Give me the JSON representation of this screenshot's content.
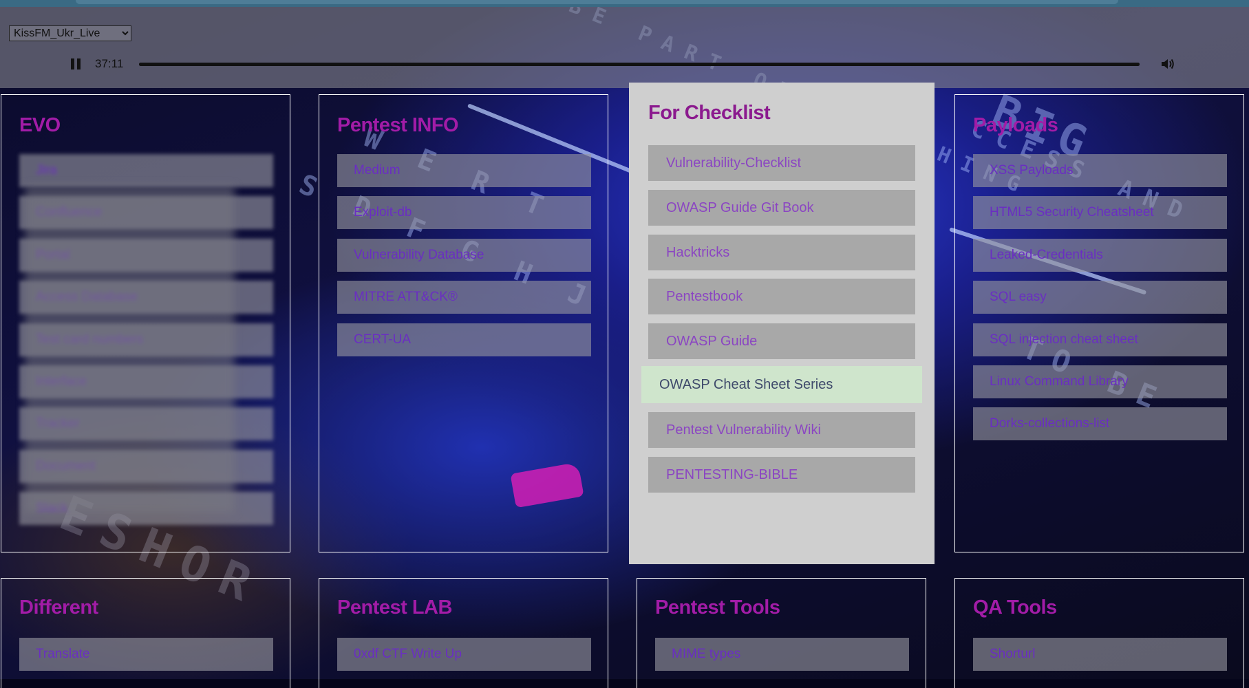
{
  "player": {
    "station": "KissFM_Ukr_Live",
    "time": "37:11",
    "progress": 1.0,
    "pause_icon": "pause-icon",
    "volume_icon": "volume-icon"
  },
  "sections": {
    "evo": {
      "title": "EVO",
      "items": [
        "Jira",
        "Confluence",
        "Portal",
        "Access Database",
        "Test card numbers",
        "Interface",
        "Tracker",
        "Document",
        "Slack"
      ]
    },
    "pentest_info": {
      "title": "Pentest INFO",
      "items": [
        "Medium",
        "Exploit-db",
        "Vulnerability Database",
        "MITRE ATT&CK®",
        "CERT-UA"
      ]
    },
    "for_checklist": {
      "title": "For Checklist",
      "items": [
        "Vulnerability-Checklist",
        "OWASP Guide Git Book",
        "Hacktricks",
        "Pentestbook",
        "OWASP Guide",
        "OWASP Cheat Sheet Series",
        "Pentest Vulnerability Wiki",
        "PENTESTING-BIBLE"
      ],
      "hovered": "OWASP Cheat Sheet Series"
    },
    "payloads": {
      "title": "Payloads",
      "items": [
        "XSS Payloads",
        "HTML5 Security Cheatsheet",
        "Leaked-Credentials",
        "SQL easy",
        "SQL injection cheat sheet",
        "Linux Command Library",
        "Dorks-collections-list"
      ]
    },
    "different": {
      "title": "Different",
      "items": [
        "Translate"
      ]
    },
    "pentest_lab": {
      "title": "Pentest LAB",
      "items": [
        "0xdf CTF Write Up"
      ]
    },
    "pentest_tools": {
      "title": "Pentest Tools",
      "items": [
        "MIME types"
      ]
    },
    "qa_tools": {
      "title": "QA Tools",
      "items": [
        "Shorturl"
      ]
    }
  },
  "colors": {
    "heading": "#a21ca7",
    "link_text": "#6a2ec2",
    "hover_bg": "#cfe5cc"
  }
}
